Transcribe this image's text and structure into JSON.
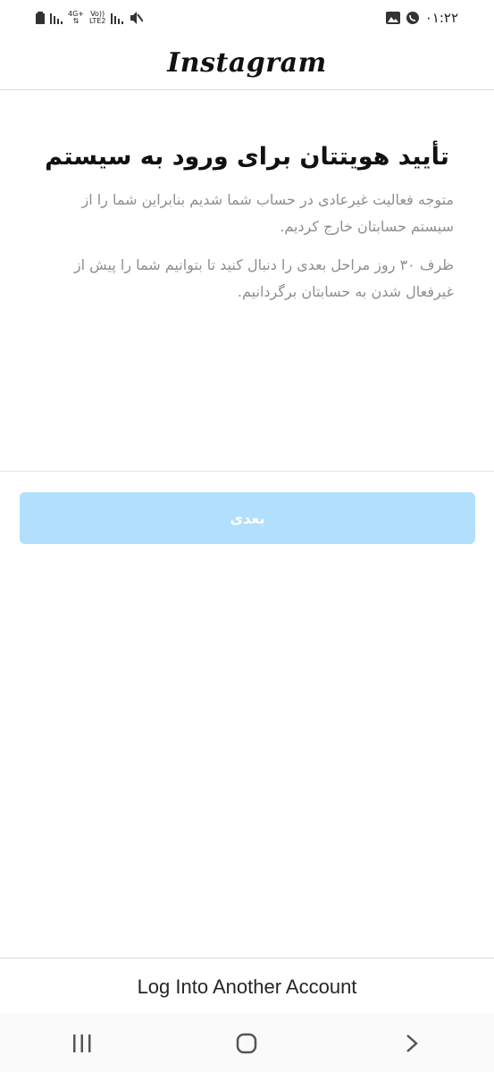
{
  "status_bar": {
    "network_top": "4G+",
    "network_bottom": "LTE2",
    "volte": "Vo))",
    "time": "۰۱:۲۲"
  },
  "header": {
    "brand": "Instagram"
  },
  "main": {
    "title": "تأیید هویتتان برای ورود به سیستم",
    "paragraph1": "متوجه فعالیت غیرعادی در حساب شما شدیم بنابراین شما را از سیستم حسابتان خارج کردیم.",
    "paragraph2": "ظرف ۳۰ روز مراحل بعدی را دنبال کنید تا بتوانیم شما را پیش از غیرفعال شدن به حسابتان برگردانیم."
  },
  "next_button": {
    "label": "بعدی",
    "color": "#b2dffc"
  },
  "footer": {
    "another_account": "Log Into Another Account"
  },
  "nav": {
    "recents_icon": "recents-icon",
    "home_icon": "home-icon",
    "back_icon": "back-icon"
  }
}
